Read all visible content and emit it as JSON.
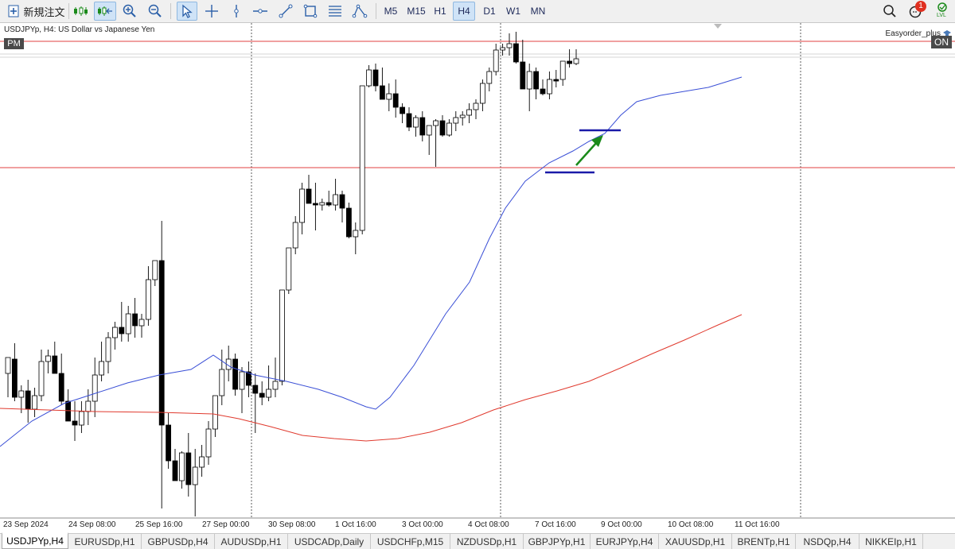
{
  "toolbar": {
    "new_order_label": "新規注文",
    "timeframes": [
      "M5",
      "M15",
      "H1",
      "H4",
      "D1",
      "W1",
      "MN"
    ],
    "active_timeframe": "H4",
    "notification_count": "1",
    "lvl_label": "LVL"
  },
  "chart": {
    "symbol_label": "USDJPYp, H4:  US Dollar vs Japanese Yen",
    "pm_badge": "PM",
    "ea_label": "Easyorder_plus",
    "on_badge": "ON",
    "date_labels": [
      "23 Sep 2024",
      "24 Sep 08:00",
      "25 Sep 16:00",
      "27 Sep 00:00",
      "30 Sep 08:00",
      "1 Oct 16:00",
      "3 Oct 00:00",
      "4 Oct 08:00",
      "7 Oct 16:00",
      "9 Oct 00:00",
      "10 Oct 08:00",
      "11 Oct 16:00"
    ],
    "colors": {
      "ma_fast": "#3a4fd6",
      "ma_slow": "#e03a2e",
      "hline": "#e04040",
      "annotation_line": "#1a1aa8",
      "annotation_arrow": "#1a8a1a"
    }
  },
  "tabs": {
    "items": [
      "USDJPYp,H4",
      "EURUSDp,H1",
      "GBPUSDp,H4",
      "AUDUSDp,H1",
      "USDCADp,Daily",
      "USDCHFp,M15",
      "NZDUSDp,H1",
      "GBPJPYp,H1",
      "EURJPYp,H4",
      "XAUUSDp,H1",
      "BRENTp,H1",
      "NSDQp,H4",
      "NIKKEIp,H1"
    ],
    "active": "USDJPYp,H4"
  }
}
